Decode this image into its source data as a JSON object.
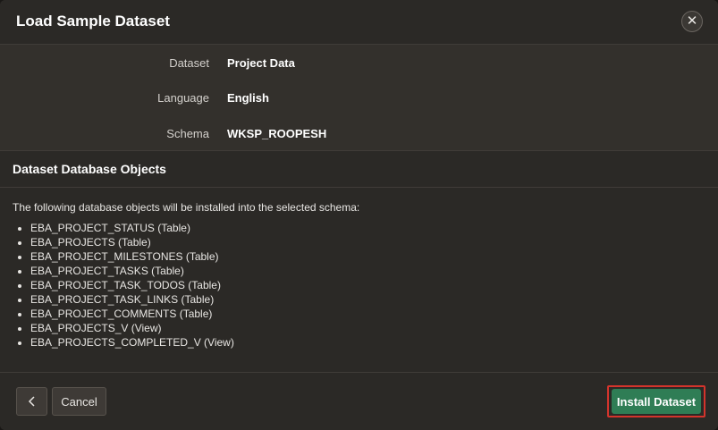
{
  "dialog": {
    "title": "Load Sample Dataset",
    "close_icon": "close-icon"
  },
  "form": {
    "dataset_label": "Dataset",
    "dataset_value": "Project Data",
    "language_label": "Language",
    "language_value": "English",
    "schema_label": "Schema",
    "schema_value": "WKSP_ROOPESH"
  },
  "objects_region": {
    "title": "Dataset Database Objects",
    "intro": "The following database objects will be installed into the selected schema:",
    "items": [
      "EBA_PROJECT_STATUS (Table)",
      "EBA_PROJECTS (Table)",
      "EBA_PROJECT_MILESTONES (Table)",
      "EBA_PROJECT_TASKS (Table)",
      "EBA_PROJECT_TASK_TODOS (Table)",
      "EBA_PROJECT_TASK_LINKS (Table)",
      "EBA_PROJECT_COMMENTS (Table)",
      "EBA_PROJECTS_V (View)",
      "EBA_PROJECTS_COMPLETED_V (View)"
    ]
  },
  "footer": {
    "back_icon": "chevron-left-icon",
    "cancel_label": "Cancel",
    "install_label": "Install Dataset"
  },
  "colors": {
    "dialog_bg": "#33302c",
    "region_bg": "#2b2926",
    "primary_button": "#2f7d55",
    "highlight_border": "#d4342c"
  }
}
